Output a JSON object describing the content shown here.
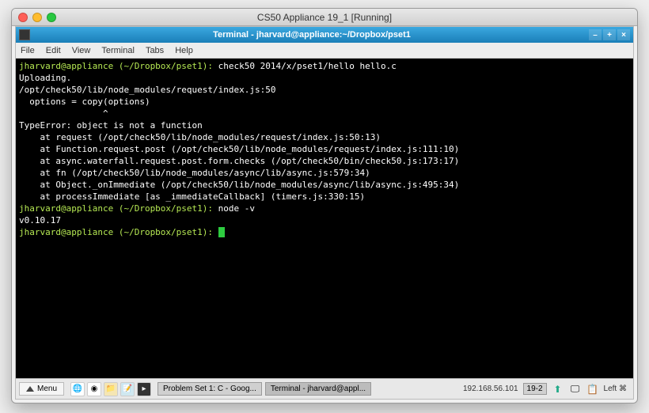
{
  "mac_title": "CS50 Appliance 19_1 [Running]",
  "xfce_title": "Terminal - jharvard@appliance:~/Dropbox/pset1",
  "menubar": [
    "File",
    "Edit",
    "View",
    "Terminal",
    "Tabs",
    "Help"
  ],
  "terminal_lines": [
    {
      "prompt": "jharvard@appliance (~/Dropbox/pset1):",
      "cmd": " check50 2014/x/pset1/hello hello.c"
    },
    {
      "text": "Uploading."
    },
    {
      "text": "/opt/check50/lib/node_modules/request/index.js:50"
    },
    {
      "text": "  options = copy(options)"
    },
    {
      "text": "                ^"
    },
    {
      "text": "TypeError: object is not a function"
    },
    {
      "text": "    at request (/opt/check50/lib/node_modules/request/index.js:50:13)"
    },
    {
      "text": "    at Function.request.post (/opt/check50/lib/node_modules/request/index.js:111:10)"
    },
    {
      "text": "    at async.waterfall.request.post.form.checks (/opt/check50/bin/check50.js:173:17)"
    },
    {
      "text": "    at fn (/opt/check50/lib/node_modules/async/lib/async.js:579:34)"
    },
    {
      "text": "    at Object._onImmediate (/opt/check50/lib/node_modules/async/lib/async.js:495:34)"
    },
    {
      "text": "    at processImmediate [as _immediateCallback] (timers.js:330:15)"
    },
    {
      "prompt": "jharvard@appliance (~/Dropbox/pset1):",
      "cmd": " node -v"
    },
    {
      "text": "v0.10.17"
    },
    {
      "prompt": "jharvard@appliance (~/Dropbox/pset1):",
      "cursor": true
    }
  ],
  "taskbar": {
    "menu_label": "Menu",
    "tasks": [
      {
        "label": "Problem Set 1: C - Goog...",
        "active": false
      },
      {
        "label": "Terminal - jharvard@appl...",
        "active": true
      }
    ],
    "ip": "192.168.56.101",
    "workspace": "19-2",
    "left_label": "Left ⌘"
  }
}
